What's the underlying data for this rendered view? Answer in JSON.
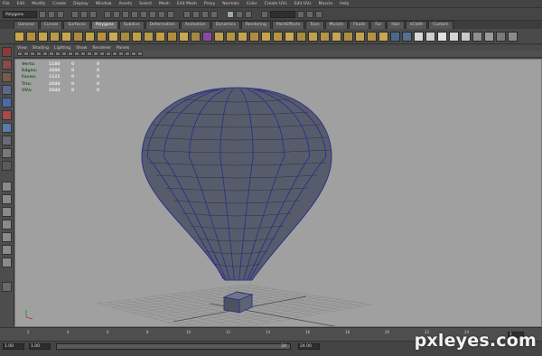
{
  "menubar": [
    "File",
    "Edit",
    "Modify",
    "Create",
    "Display",
    "Window",
    "Assets",
    "Select",
    "Mesh",
    "Edit Mesh",
    "Proxy",
    "Normals",
    "Color",
    "Create UVs",
    "Edit UVs",
    "Muscle",
    "Help"
  ],
  "status_line": {
    "mode": "Polygons"
  },
  "shelf_tabs": [
    "General",
    "Curves",
    "Surfaces",
    "Polygons",
    "Subdivs",
    "Deformation",
    "Animation",
    "Dynamics",
    "Rendering",
    "PaintEffects",
    "Toon",
    "Muscle",
    "Fluids",
    "Fur",
    "Hair",
    "nCloth",
    "Custom"
  ],
  "active_shelf_tab": "Polygons",
  "panel_menu": [
    "View",
    "Shading",
    "Lighting",
    "Show",
    "Renderer",
    "Panels"
  ],
  "hud": [
    {
      "label": "Verts:",
      "value": "1180",
      "a": "0",
      "b": "0"
    },
    {
      "label": "Edges:",
      "value": "2090",
      "a": "0",
      "b": "0"
    },
    {
      "label": "Faces:",
      "value": "1121",
      "a": "0",
      "b": "0"
    },
    {
      "label": "Tris:",
      "value": "2040",
      "a": "0",
      "b": "0"
    },
    {
      "label": "UVs:",
      "value": "2040",
      "a": "0",
      "b": "0"
    }
  ],
  "timeline": {
    "start": "1.00",
    "end": "24.00",
    "range_start": "1.00",
    "range_end": "24",
    "current": "1",
    "ticks": [
      "2",
      "4",
      "6",
      "8",
      "10",
      "12",
      "14",
      "16",
      "18",
      "20",
      "22",
      "24"
    ]
  },
  "watermark": "pxleyes.com",
  "colors": {
    "viewport_bg": "#a0a0a0",
    "balloon_fill": "#555b6a",
    "wire": "#2e2f8c",
    "grid": "#8a8a8a",
    "hud_label": "#2a5c2a"
  }
}
